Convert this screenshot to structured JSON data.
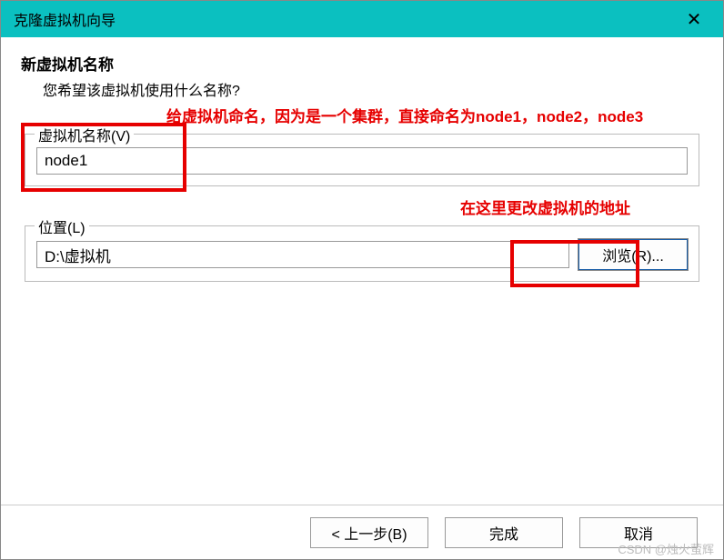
{
  "titlebar": {
    "title": "克隆虚拟机向导"
  },
  "header": {
    "heading": "新虚拟机名称",
    "subheading": "您希望该虚拟机使用什么名称?"
  },
  "annotations": {
    "naming_hint": "给虚拟机命名，因为是一个集群，直接命名为node1，node2，node3",
    "location_hint": "在这里更改虚拟机的地址"
  },
  "fields": {
    "name": {
      "legend": "虚拟机名称(V)",
      "value": "node1"
    },
    "location": {
      "legend": "位置(L)",
      "value": "D:\\虚拟机",
      "browse_label": "浏览(R)..."
    }
  },
  "footer": {
    "back": "< 上一步(B)",
    "finish": "完成",
    "cancel": "取消"
  },
  "watermark": "CSDN @烛火萤辉"
}
